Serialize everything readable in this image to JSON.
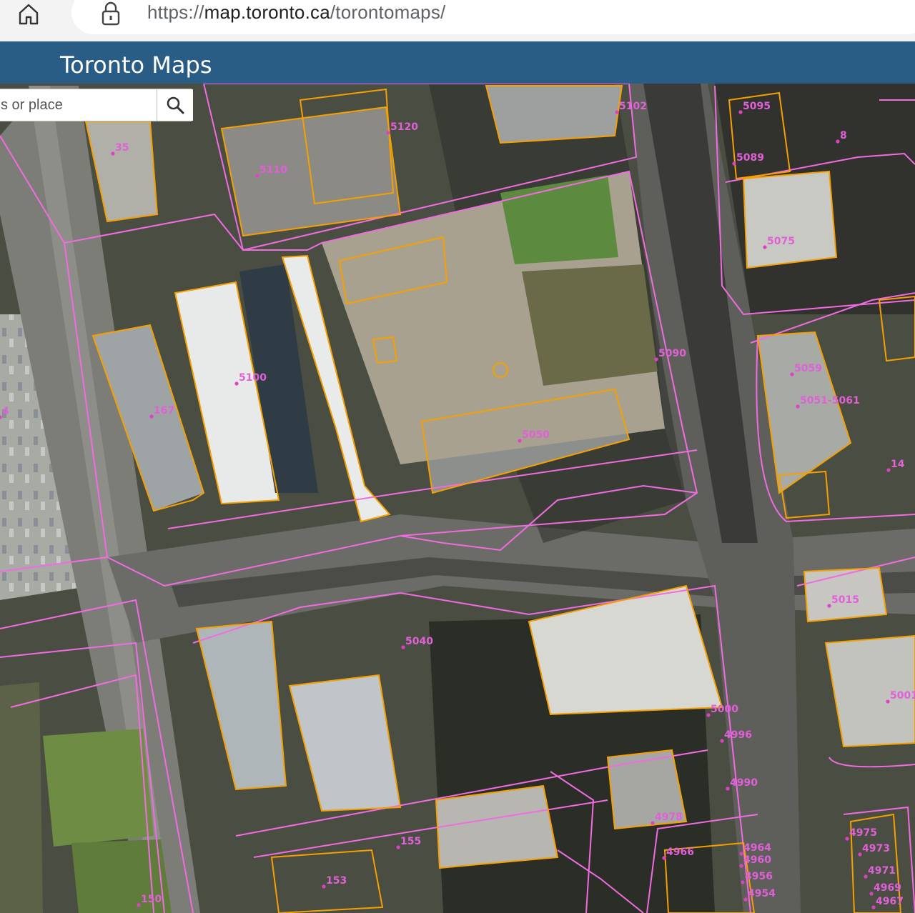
{
  "browser": {
    "url_scheme": "https://",
    "url_domain": "map.toronto.ca",
    "url_path": "/torontomaps/"
  },
  "header": {
    "title": "Toronto Maps"
  },
  "search": {
    "placeholder": "s or place"
  },
  "map": {
    "parcel_line_color": "#f06ce0",
    "building_line_color": "#f5a000",
    "address_labels": [
      "35",
      "5102",
      "5120",
      "5110",
      "5095",
      "5089",
      "5075",
      "5090",
      "5100",
      "167",
      "5050",
      "5059",
      "5051-5061",
      "5015",
      "5040",
      "5001",
      "5000",
      "4996",
      "4990",
      "4978",
      "4975",
      "4973",
      "4971",
      "4969",
      "4967",
      "4964",
      "4960",
      "4956",
      "4954",
      "4966",
      "155",
      "153",
      "150",
      "14",
      "8",
      "4"
    ]
  }
}
